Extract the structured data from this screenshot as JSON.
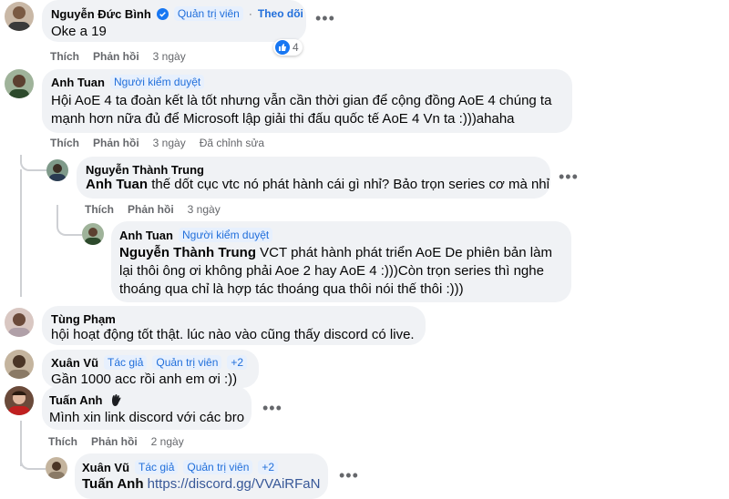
{
  "actions": {
    "like": "Thích",
    "reply": "Phản hồi",
    "edited": "Đã chỉnh sửa",
    "sep": "·"
  },
  "comments": [
    {
      "name": "Nguyễn Đức Bình",
      "badge": "Quản trị viên",
      "follow": "Theo dõi",
      "text": "Oke a 19",
      "reactions": "4",
      "time": "3 ngày"
    },
    {
      "name": "Anh Tuan",
      "badge": "Người kiểm duyệt",
      "text": "Hội AoE 4 ta đoàn kết là tốt nhưng vẫn cần thời gian để cộng đồng AoE 4 chúng ta mạnh hơn nữa đủ để Microsoft lập giải thi đấu quốc tế AoE 4 Vn ta :)))ahaha",
      "time": "3 ngày"
    },
    {
      "name": "Nguyễn Thành Trung",
      "mention": "Anh Tuan",
      "text": " thế dốt cục vtc nó phát hành cái gì nhỉ? Bảo trọn series cơ mà nhỉ",
      "time": "3 ngày"
    },
    {
      "name": "Anh Tuan",
      "badge": "Người kiểm duyệt",
      "mention": "Nguyễn Thành Trung",
      "text": " VCT phát hành phát triển AoE De phiên bản làm lại thôi ông ơi không phải Aoe 2 hay AoE 4 :)))Còn trọn series thì nghe thoáng qua chỉ là hợp tác thoáng qua thôi nói thế thôi :)))"
    },
    {
      "name": "Tùng Phạm",
      "text": "hội hoạt động tốt thật. lúc nào vào cũng thấy discord có live."
    },
    {
      "name": "Xuân Vũ",
      "badge": "Tác giả",
      "badge2": "Quản trị viên",
      "more": "+2",
      "text": "Gần 1000 acc rồi anh em ơi :))"
    },
    {
      "name": "Tuấn Anh",
      "text": "Mình xin link discord với các bro",
      "time": "2 ngày"
    },
    {
      "name": "Xuân Vũ",
      "badge": "Tác giả",
      "badge2": "Quản trị viên",
      "more": "+2",
      "mention": "Tuấn Anh",
      "link": "https://discord.gg/VVAiRFaN"
    }
  ],
  "icons": {
    "verified": "verified-badge-icon",
    "like": "like-icon",
    "more": "more-options-icon",
    "wave": "wave-badge-icon"
  },
  "colors": {
    "bubble": "#f0f2f5",
    "badge_text": "#216fdb",
    "meta": "#65676b",
    "like": "#1877f2"
  }
}
